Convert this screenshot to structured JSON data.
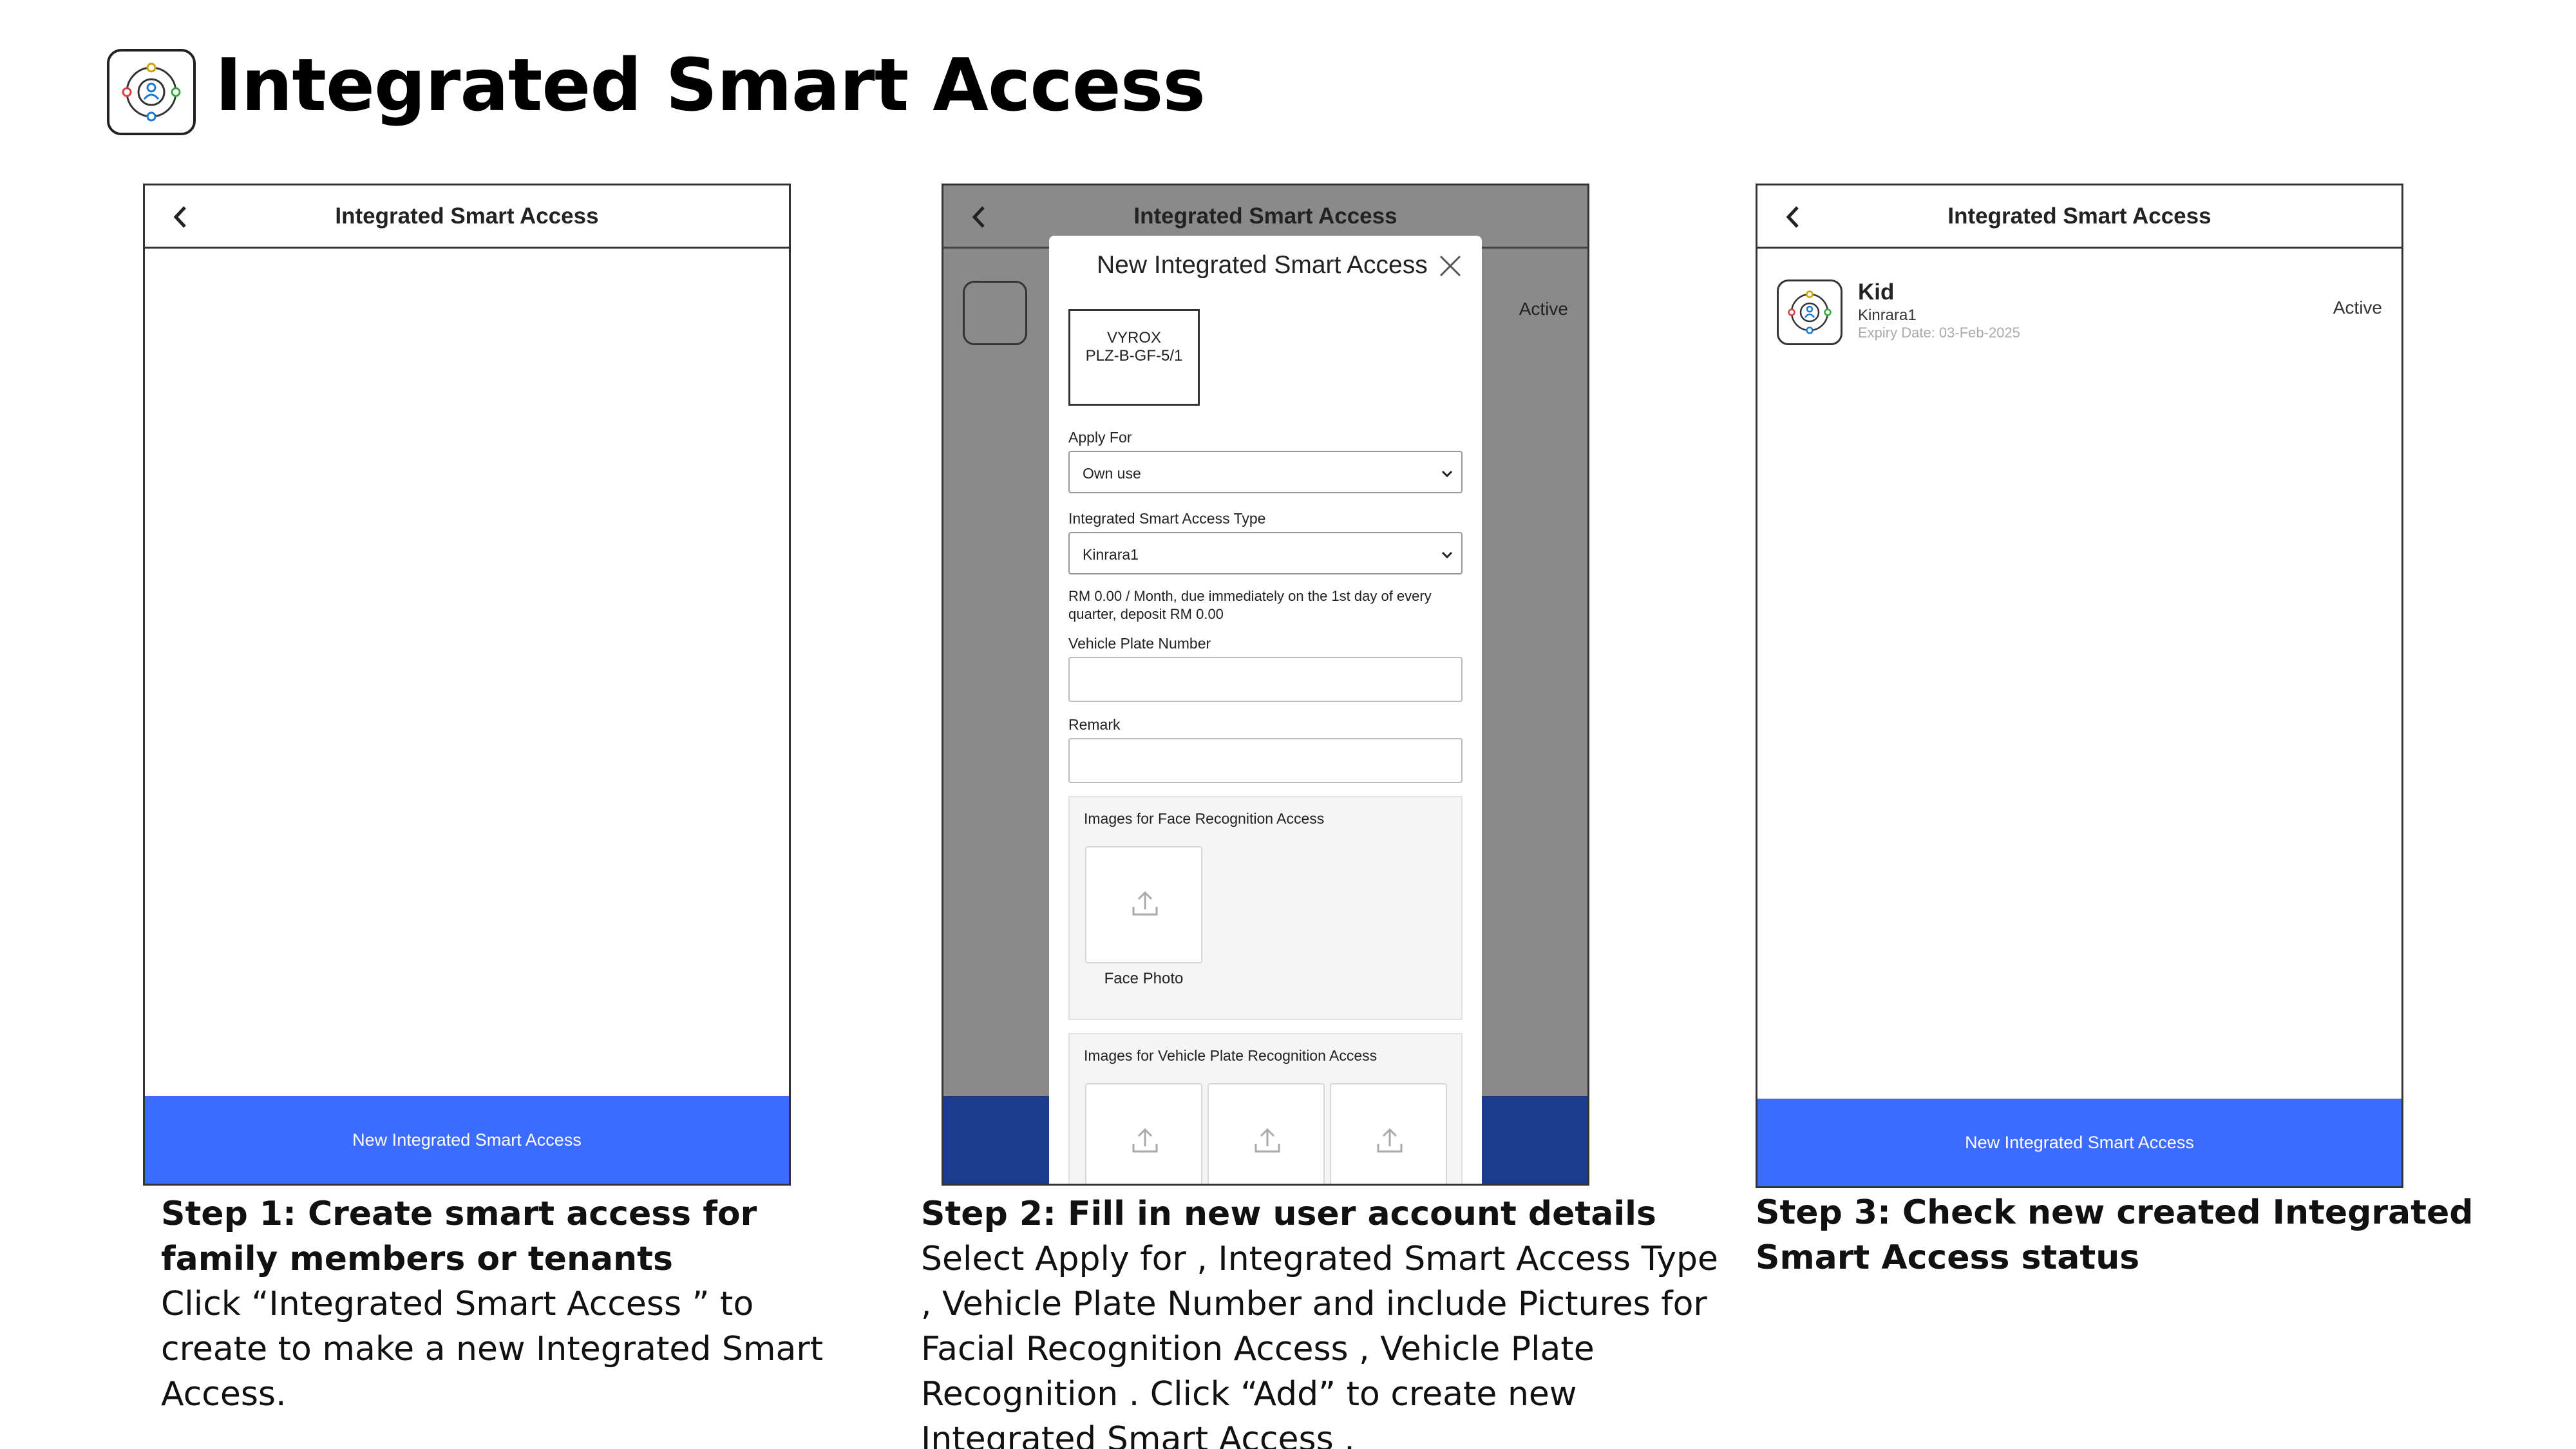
{
  "header": {
    "title": "Integrated Smart Access",
    "logo_icon": "smart-access-logo-icon"
  },
  "colors": {
    "primary_button": "#3b6cff",
    "overlay_gray": "#8a8a8a",
    "dimmed_button": "#1c3b8c"
  },
  "screen1": {
    "appbar_title": "Integrated Smart Access",
    "bottom_button": "New Integrated Smart Access"
  },
  "screen2": {
    "appbar_title": "Integrated Smart Access",
    "background_status": "Active",
    "modal": {
      "title": "New Integrated Smart Access",
      "property_line1": "VYROX",
      "property_line2": "PLZ-B-GF-5/1",
      "apply_for_label": "Apply For",
      "apply_for_value": "Own use",
      "type_label": "Integrated Smart Access Type",
      "type_value": "Kinrara1",
      "fee_text": "RM 0.00 / Month, due immediately on the 1st day of every quarter, deposit RM 0.00",
      "plate_label": "Vehicle Plate Number",
      "plate_value": "",
      "remark_label": "Remark",
      "remark_value": "",
      "face_section_title": "Images for Face Recognition Access",
      "face_tile_caption": "Face Photo",
      "vehicle_section_title": "Images for Vehicle Plate Recognition Access"
    }
  },
  "screen3": {
    "appbar_title": "Integrated Smart Access",
    "item": {
      "name": "Kid",
      "type": "Kinrara1",
      "expiry": "Expiry Date: 03-Feb-2025",
      "status": "Active"
    },
    "bottom_button": "New Integrated Smart Access"
  },
  "captions": {
    "step1_title": "Step 1: Create smart access for family members or tenants",
    "step1_body": "Click “Integrated Smart Access ” to create to make a new Integrated Smart Access.",
    "step2_title": "Step 2: Fill in new user account details",
    "step2_body": "Select Apply for , Integrated Smart Access Type , Vehicle Plate Number and include Pictures for Facial Recognition Access , Vehicle Plate Recognition . Click “Add” to create new Integrated Smart Access .",
    "step3_title": "Step 3: Check new created Integrated Smart Access status"
  }
}
